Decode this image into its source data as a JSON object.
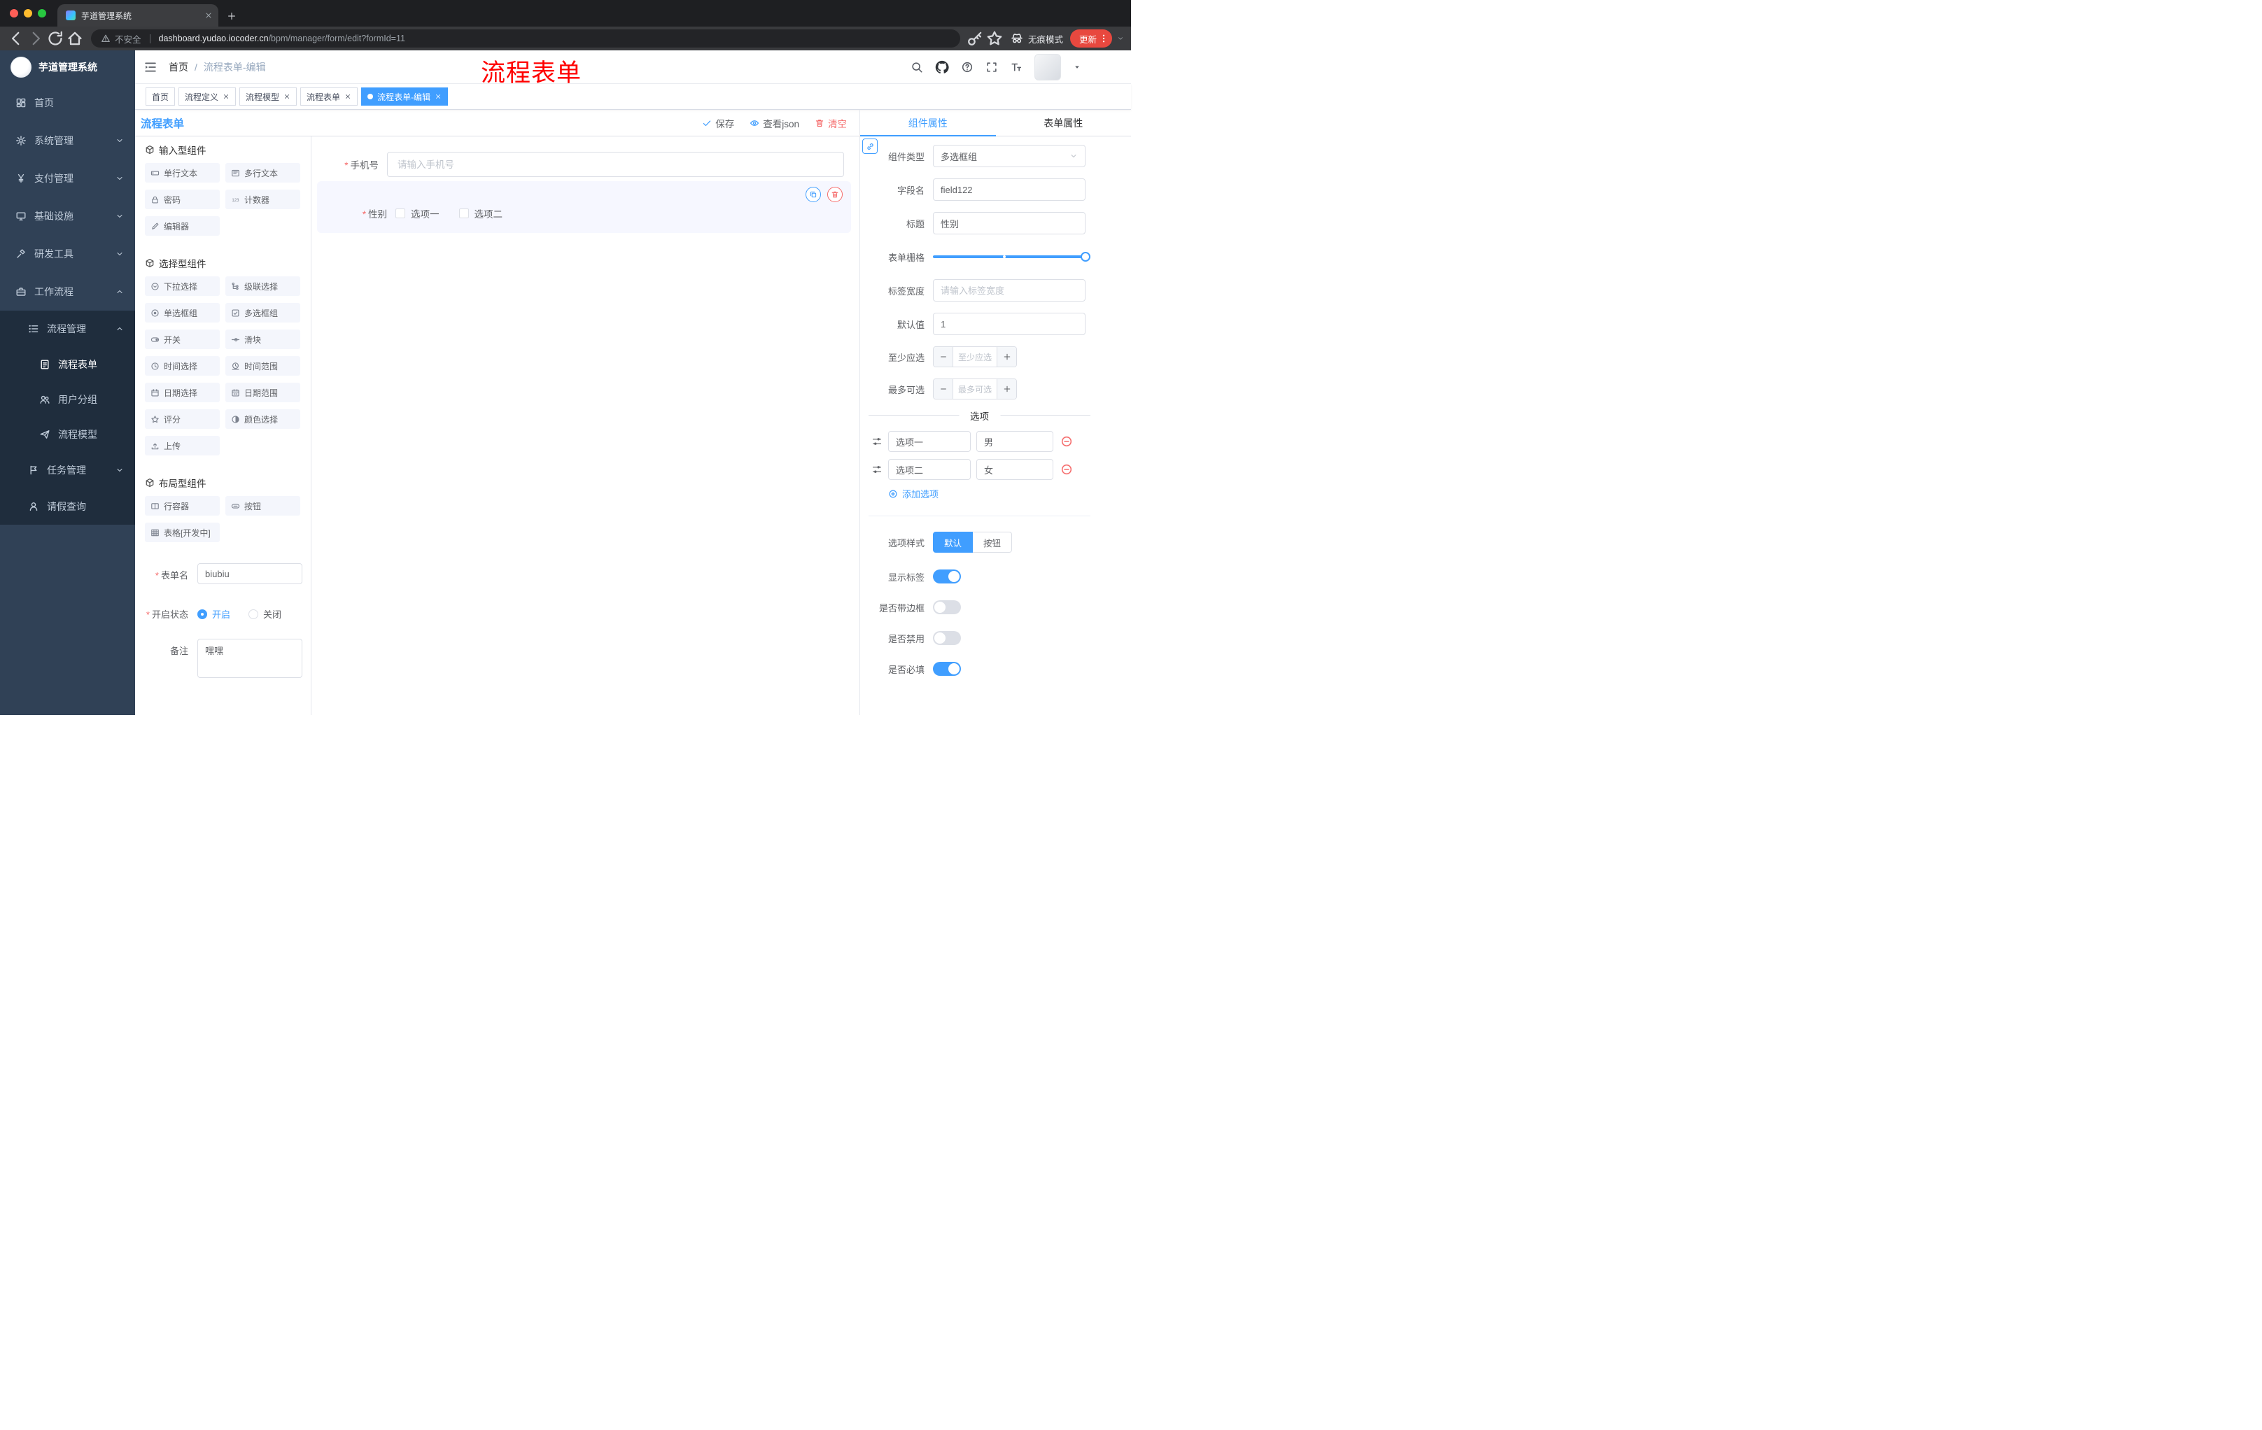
{
  "browser": {
    "tab_title": "芋道管理系统",
    "security_label": "不安全",
    "url_domain": "dashboard.yudao.iocoder.cn",
    "url_path": "/bpm/manager/form/edit?formId=11",
    "incognito_label": "无痕模式",
    "update_label": "更新"
  },
  "navbar": {
    "breadcrumb": {
      "home": "首页",
      "separator": "/",
      "current": "流程表单-编辑"
    },
    "annotation": "流程表单"
  },
  "sidebar": {
    "logo_title": "芋道管理系统",
    "items": [
      {
        "label": "首页",
        "icon": "dashboard"
      },
      {
        "label": "系统管理",
        "icon": "gear"
      },
      {
        "label": "支付管理",
        "icon": "yen"
      },
      {
        "label": "基础设施",
        "icon": "monitor"
      },
      {
        "label": "研发工具",
        "icon": "tool"
      },
      {
        "label": "工作流程",
        "icon": "briefcase"
      },
      {
        "label": "流程管理",
        "icon": "listicon"
      },
      {
        "label": "流程表单",
        "icon": "formdoc"
      },
      {
        "label": "用户分组",
        "icon": "users"
      },
      {
        "label": "流程模型",
        "icon": "send"
      },
      {
        "label": "任务管理",
        "icon": "tasks"
      },
      {
        "label": "请假查询",
        "icon": "user"
      }
    ]
  },
  "tags": [
    {
      "label": "首页"
    },
    {
      "label": "流程定义"
    },
    {
      "label": "流程模型"
    },
    {
      "label": "流程表单"
    },
    {
      "label": "流程表单-编辑"
    }
  ],
  "designer": {
    "title": "流程表单",
    "actions": {
      "save": "保存",
      "view_json": "查看json",
      "clear": "清空"
    },
    "palette": {
      "sections": [
        {
          "title": "输入型组件",
          "items": [
            {
              "label": "单行文本",
              "icon": "cinput"
            },
            {
              "label": "多行文本",
              "icon": "ctextarea"
            },
            {
              "label": "密码",
              "icon": "lock"
            },
            {
              "label": "计数器",
              "icon": "counter"
            },
            {
              "label": "编辑器",
              "icon": "editor"
            }
          ]
        },
        {
          "title": "选择型组件",
          "items": [
            {
              "label": "下拉选择",
              "icon": "selecticon"
            },
            {
              "label": "级联选择",
              "icon": "cascader"
            },
            {
              "label": "单选框组",
              "icon": "radioicon"
            },
            {
              "label": "多选框组",
              "icon": "checkboxicon"
            },
            {
              "label": "开关",
              "icon": "switchicon"
            },
            {
              "label": "滑块",
              "icon": "slidericon"
            },
            {
              "label": "时间选择",
              "icon": "clock"
            },
            {
              "label": "时间范围",
              "icon": "timerange"
            },
            {
              "label": "日期选择",
              "icon": "calendar"
            },
            {
              "label": "日期范围",
              "icon": "calendarrange"
            },
            {
              "label": "评分",
              "icon": "star"
            },
            {
              "label": "颜色选择",
              "icon": "coloricon"
            },
            {
              "label": "上传",
              "icon": "upload"
            }
          ]
        },
        {
          "title": "布局型组件",
          "items": [
            {
              "label": "行容器",
              "icon": "rowicon"
            },
            {
              "label": "按钮",
              "icon": "buttonicon"
            },
            {
              "label": "表格[开发中]",
              "icon": "tableicon"
            }
          ]
        }
      ]
    },
    "meta": {
      "name_label": "表单名",
      "name_value": "biubiu",
      "status_label": "开启状态",
      "status_on": "开启",
      "status_off": "关闭",
      "remark_label": "备注",
      "remark_value": "嘿嘿"
    },
    "canvas": {
      "phone_label": "手机号",
      "phone_placeholder": "请输入手机号",
      "gender_label": "性别",
      "gender_options": [
        "选项一",
        "选项二"
      ]
    }
  },
  "props": {
    "tabs": [
      "组件属性",
      "表单属性"
    ],
    "type_label": "组件类型",
    "type_value": "多选框组",
    "field_label": "字段名",
    "field_value": "field122",
    "title_label": "标题",
    "title_value": "性别",
    "grid_label": "表单栅格",
    "label_width_label": "标签宽度",
    "label_width_placeholder": "请输入标签宽度",
    "default_label": "默认值",
    "default_value": "1",
    "min_label": "至少应选",
    "min_placeholder": "至少应选",
    "max_label": "最多可选",
    "max_placeholder": "最多可选",
    "options_title": "选项",
    "options": [
      {
        "label": "选项一",
        "value": "男"
      },
      {
        "label": "选项二",
        "value": "女"
      }
    ],
    "add_option": "添加选项",
    "style_label": "选项样式",
    "style_options": [
      "默认",
      "按钮"
    ],
    "toggles": [
      {
        "label": "显示标签",
        "on": true
      },
      {
        "label": "是否带边框",
        "on": false
      },
      {
        "label": "是否禁用",
        "on": false
      },
      {
        "label": "是否必填",
        "on": true
      }
    ]
  },
  "colors": {
    "accent": "#409eff",
    "danger": "#f56c6c",
    "annotation": "#ff0000",
    "sidebar_bg": "#304156"
  }
}
